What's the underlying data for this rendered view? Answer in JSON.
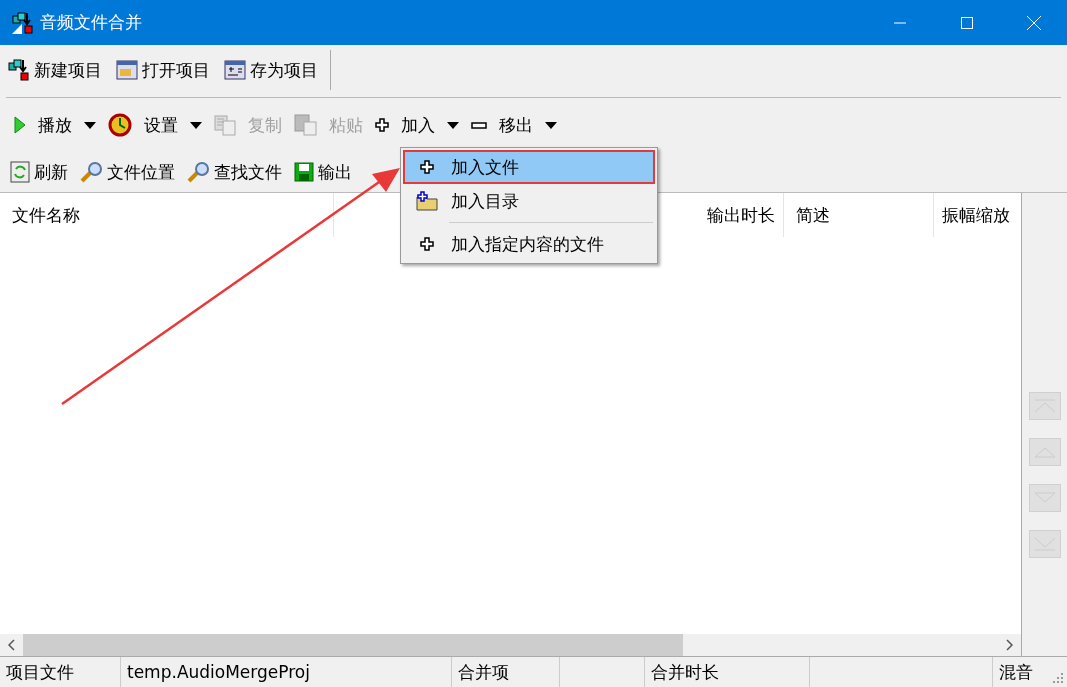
{
  "window": {
    "title": "音频文件合并"
  },
  "toolbar_project": [
    {
      "label": "新建项目"
    },
    {
      "label": "打开项目"
    },
    {
      "label": "存为项目"
    }
  ],
  "toolbar_main": [
    {
      "label": "播放",
      "disabled": false,
      "dropdown": true
    },
    {
      "label": "设置",
      "disabled": false,
      "dropdown": true
    },
    {
      "label": "复制",
      "disabled": true,
      "dropdown": false
    },
    {
      "label": "粘贴",
      "disabled": true,
      "dropdown": false
    },
    {
      "label": "加入",
      "disabled": false,
      "dropdown": true
    },
    {
      "label": "移出",
      "disabled": false,
      "dropdown": true
    }
  ],
  "toolbar_file": [
    {
      "label": "刷新"
    },
    {
      "label": "文件位置"
    },
    {
      "label": "查找文件"
    },
    {
      "label": "输出"
    }
  ],
  "table": {
    "columns": [
      {
        "label": "文件名称"
      },
      {
        "label": "输出时长"
      },
      {
        "label": "简述"
      },
      {
        "label": "振幅缩放"
      }
    ]
  },
  "add_menu": [
    {
      "label": "加入文件",
      "selected": true,
      "separator_before": false
    },
    {
      "label": "加入目录",
      "selected": false,
      "separator_before": false
    },
    {
      "label": "加入指定内容的文件",
      "selected": false,
      "separator_before": true
    }
  ],
  "status_bar": [
    {
      "text": "项目文件"
    },
    {
      "text": "temp.AudioMergeProj"
    },
    {
      "text": "合并项"
    },
    {
      "text": "合并时长"
    },
    {
      "text": "混音"
    }
  ]
}
